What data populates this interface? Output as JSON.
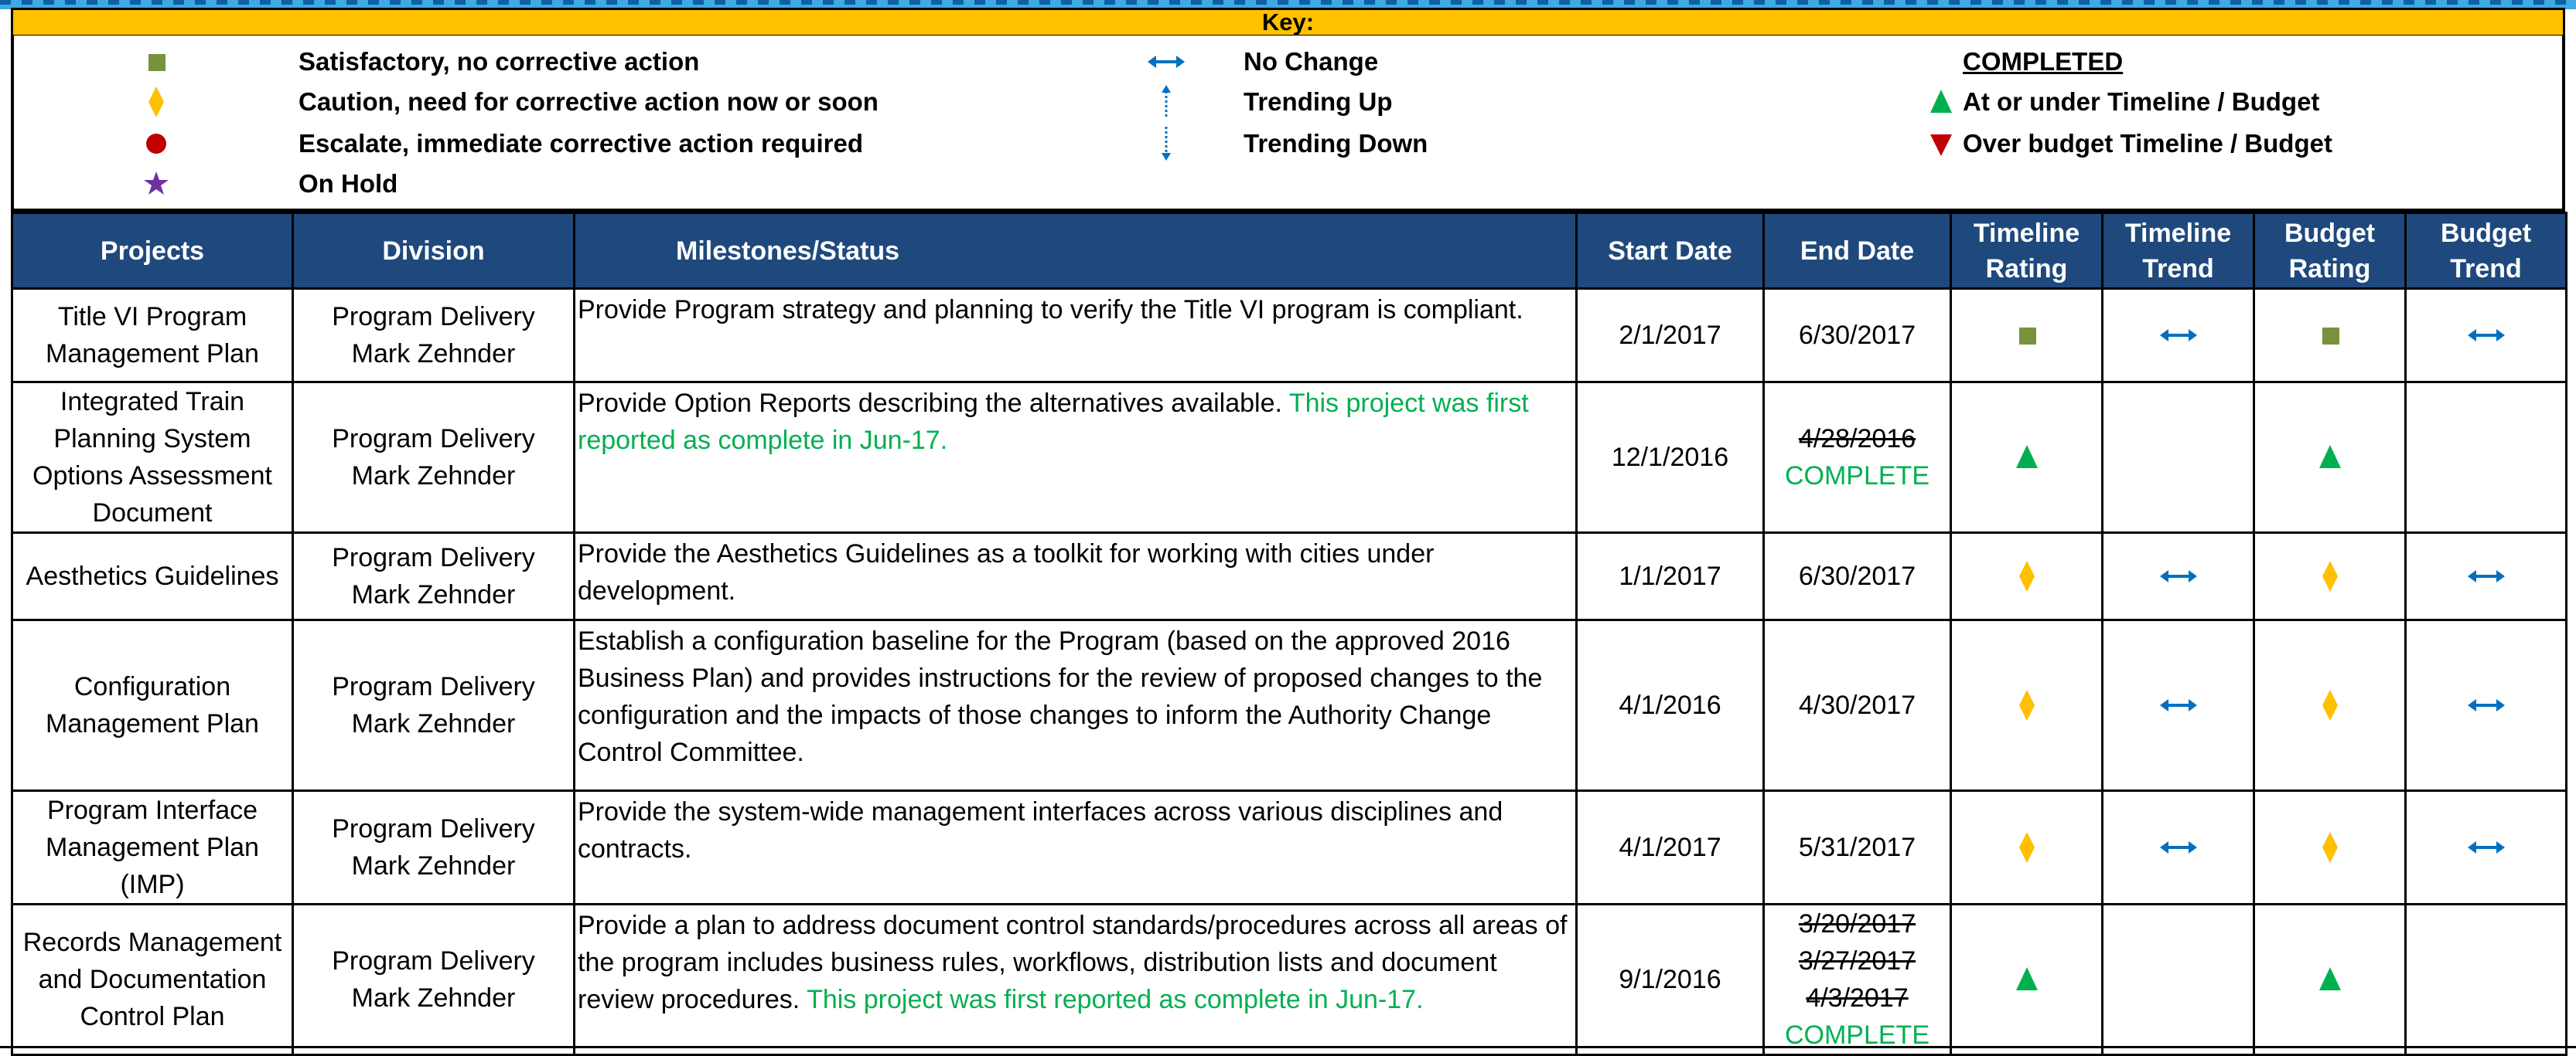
{
  "key": {
    "title": "Key:",
    "col1": [
      {
        "symbol": "green-square",
        "label": "Satisfactory, no corrective action"
      },
      {
        "symbol": "yellow-diamond",
        "label": "Caution, need for corrective action now or soon"
      },
      {
        "symbol": "red-circle",
        "label": "Escalate, immediate corrective action required"
      },
      {
        "symbol": "purple-star",
        "label": "On Hold"
      }
    ],
    "col2": [
      {
        "symbol": "double-arrow",
        "label": "No Change"
      },
      {
        "symbol": "up-arrow",
        "label": "Trending Up"
      },
      {
        "symbol": "down-arrow",
        "label": "Trending Down"
      }
    ],
    "col3": {
      "heading": "COMPLETED",
      "items": [
        {
          "symbol": "green-triangle-up",
          "label": "At or under Timeline / Budget"
        },
        {
          "symbol": "red-triangle-down",
          "label": "Over budget Timeline / Budget"
        }
      ]
    }
  },
  "colors": {
    "header_bg": "#1f497d",
    "key_bar": "#ffc000",
    "satisfactory": "#77933c",
    "caution": "#ffc000",
    "escalate": "#c00000",
    "on_hold": "#7030a0",
    "trend_arrow": "#0070c0",
    "completed_green": "#00b050",
    "over_budget": "#c00000"
  },
  "table": {
    "headers": {
      "projects": "Projects",
      "division": "Division",
      "milestones": "Milestones/Status",
      "start": "Start Date",
      "end": "End Date",
      "timeline_rating": [
        "Timeline",
        "Rating"
      ],
      "timeline_trend": [
        "Timeline",
        "Trend"
      ],
      "budget_rating": [
        "Budget",
        "Rating"
      ],
      "budget_trend": [
        "Budget",
        "Trend"
      ]
    },
    "rows": [
      {
        "project": [
          "Title VI Program",
          "Management Plan"
        ],
        "division": [
          "Program Delivery",
          "Mark Zehnder"
        ],
        "milestone": "Provide Program strategy and planning to verify the Title VI program is compliant.",
        "milestone_note": "",
        "start": "2/1/2017",
        "end_struck": [],
        "end": "6/30/2017",
        "end_complete": "",
        "timeline_rating": "green-square",
        "timeline_trend": "double-arrow",
        "budget_rating": "green-square",
        "budget_trend": "double-arrow"
      },
      {
        "project": [
          "Integrated Train",
          "Planning System",
          "Options Assessment",
          "Document"
        ],
        "division": [
          "Program Delivery",
          "Mark Zehnder"
        ],
        "milestone": "Provide Option Reports describing the alternatives available.",
        "milestone_note": "This project was first reported as complete in Jun-17.",
        "start": "12/1/2016",
        "end_struck": [
          "4/28/2016"
        ],
        "end": "",
        "end_complete": "COMPLETE",
        "timeline_rating": "green-triangle-up",
        "timeline_trend": "",
        "budget_rating": "green-triangle-up",
        "budget_trend": ""
      },
      {
        "project": [
          "Aesthetics Guidelines"
        ],
        "division": [
          "Program Delivery",
          "Mark Zehnder"
        ],
        "milestone": "Provide the Aesthetics Guidelines as a toolkit for working with cities under development.",
        "milestone_note": "",
        "start": "1/1/2017",
        "end_struck": [],
        "end": "6/30/2017",
        "end_complete": "",
        "timeline_rating": "yellow-diamond",
        "timeline_trend": "double-arrow",
        "budget_rating": "yellow-diamond",
        "budget_trend": "double-arrow"
      },
      {
        "project": [
          "Configuration",
          "Management Plan"
        ],
        "division": [
          "Program Delivery",
          "Mark Zehnder"
        ],
        "milestone": "Establish a configuration baseline for the Program (based on the approved 2016 Business Plan) and provides instructions for the review of proposed changes to the configuration and the impacts of those changes to inform the Authority Change Control Committee.",
        "milestone_note": "",
        "start": "4/1/2016",
        "end_struck": [],
        "end": "4/30/2017",
        "end_complete": "",
        "timeline_rating": "yellow-diamond",
        "timeline_trend": "double-arrow",
        "budget_rating": "yellow-diamond",
        "budget_trend": "double-arrow"
      },
      {
        "project": [
          "Program Interface",
          "Management Plan",
          "(IMP)"
        ],
        "division": [
          "Program Delivery",
          "Mark Zehnder"
        ],
        "milestone": "Provide the system-wide management interfaces across various disciplines and contracts.",
        "milestone_note": "",
        "start": "4/1/2017",
        "end_struck": [],
        "end": "5/31/2017",
        "end_complete": "",
        "timeline_rating": "yellow-diamond",
        "timeline_trend": "double-arrow",
        "budget_rating": "yellow-diamond",
        "budget_trend": "double-arrow"
      },
      {
        "project": [
          "Records Management",
          "and Documentation",
          "Control Plan"
        ],
        "division": [
          "Program Delivery",
          "Mark Zehnder"
        ],
        "milestone": "Provide a plan to address document control standards/procedures across all areas of the program includes business rules, workflows, distribution lists and document review procedures. ",
        "milestone_note": "This project was first reported as complete in Jun-17.",
        "start": "9/1/2016",
        "end_struck": [
          "3/20/2017",
          "3/27/2017",
          "4/3/2017"
        ],
        "end": "",
        "end_complete": "COMPLETE",
        "timeline_rating": "green-triangle-up",
        "timeline_trend": "",
        "budget_rating": "green-triangle-up",
        "budget_trend": ""
      }
    ]
  }
}
